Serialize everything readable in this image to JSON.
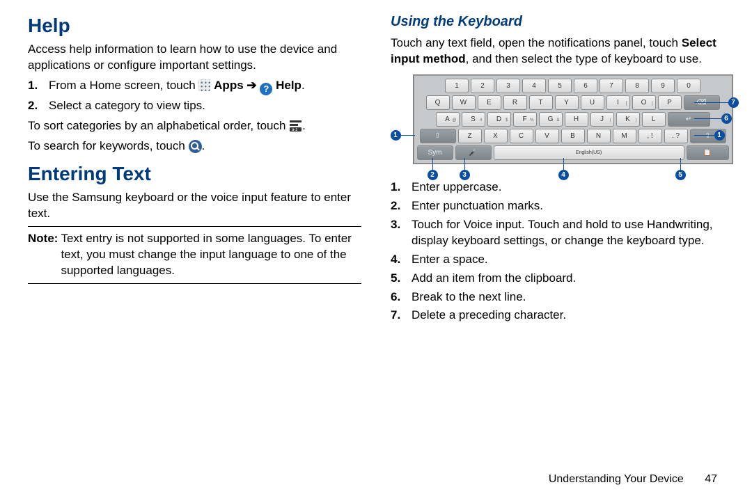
{
  "help": {
    "heading": "Help",
    "intro": "Access help information to learn how to use the device and applications or configure important settings.",
    "steps": [
      {
        "n": "1.",
        "pre": "From a Home screen, touch ",
        "apps_label": "Apps",
        "arrow": " ➔ ",
        "help_label": "Help",
        "post": "."
      },
      {
        "n": "2.",
        "text": "Select a category to view tips."
      }
    ],
    "sort_pre": "To sort categories by an alphabetical order, touch ",
    "sort_post": ".",
    "search_pre": "To search for keywords, touch ",
    "search_post": "."
  },
  "entering": {
    "heading": "Entering Text",
    "intro": "Use the Samsung keyboard or the voice input feature to enter text.",
    "note_label": "Note:",
    "note_text": " Text entry is not supported in some languages. To enter text, you must change the input language to one of the supported languages."
  },
  "using_kb": {
    "heading": "Using the Keyboard",
    "intro_a": "Touch any text field, open the notifications panel, touch ",
    "intro_bold": "Select input method",
    "intro_b": ", and then select the type of keyboard to use.",
    "steps": [
      {
        "n": "1.",
        "t": "Enter uppercase."
      },
      {
        "n": "2.",
        "t": "Enter punctuation marks."
      },
      {
        "n": "3.",
        "t": "Touch for Voice input. Touch and hold to use Handwriting, display keyboard settings, or change the keyboard type."
      },
      {
        "n": "4.",
        "t": "Enter a space."
      },
      {
        "n": "5.",
        "t": "Add an item from the clipboard."
      },
      {
        "n": "6.",
        "t": "Break to the next line."
      },
      {
        "n": "7.",
        "t": "Delete a preceding character."
      }
    ]
  },
  "keyboard_rows": {
    "row_num": [
      "1",
      "2",
      "3",
      "4",
      "5",
      "6",
      "7",
      "8",
      "9",
      "0"
    ],
    "row_q": [
      "Q",
      "W",
      "E",
      "R",
      "T",
      "Y",
      "U",
      "I",
      "O",
      "P"
    ],
    "row_q_sup": [
      "",
      "",
      "",
      "",
      "",
      "",
      "",
      "[",
      "]",
      ""
    ],
    "row_a": [
      "A",
      "S",
      "D",
      "F",
      "G",
      "H",
      "J",
      "K",
      "L"
    ],
    "row_a_sup": [
      "@",
      "#",
      "$",
      "%",
      "&",
      "",
      "(",
      ")",
      ""
    ],
    "row_z": [
      "Z",
      "X",
      "C",
      "V",
      "B",
      "N",
      "M"
    ],
    "space_label": "English(US)",
    "sym": "Sym",
    "punct1": ", !",
    "punct2": ". ?"
  },
  "callouts": {
    "c1": "1",
    "c2": "2",
    "c3": "3",
    "c4": "4",
    "c5": "5",
    "c6": "6",
    "c7": "7",
    "c1b": "1"
  },
  "footer": {
    "section": "Understanding Your Device",
    "page": "47"
  }
}
